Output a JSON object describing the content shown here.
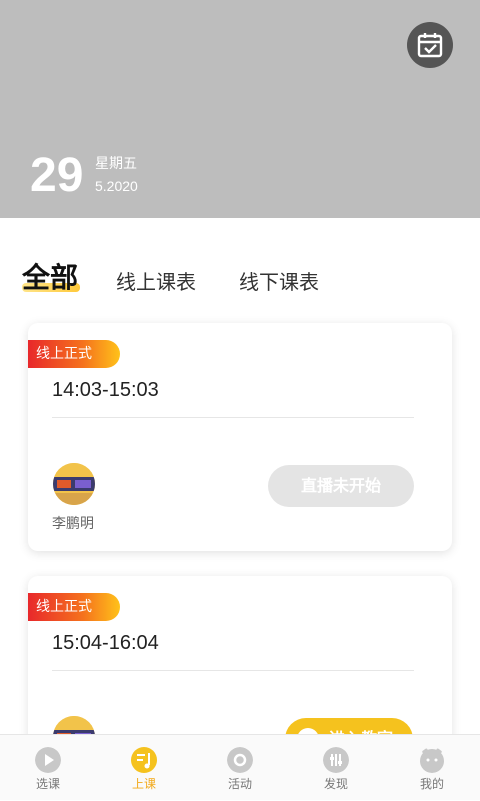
{
  "header": {
    "day": "29",
    "weekday": "星期五",
    "month_year": "5.2020",
    "calendar_icon": "calendar-check-icon"
  },
  "tabs": [
    {
      "label": "全部",
      "active": true
    },
    {
      "label": "线上课表",
      "active": false
    },
    {
      "label": "线下课表",
      "active": false
    }
  ],
  "cards": [
    {
      "badge": "线上正式",
      "time": "14:03-15:03",
      "teacher": "李鹏明",
      "action": "直播未开始",
      "action_state": "disabled"
    },
    {
      "badge": "线上正式",
      "time": "15:04-16:04",
      "action": "进入教室",
      "action_state": "enabled"
    }
  ],
  "bottom_nav": [
    {
      "label": "选课",
      "icon": "play-circle-icon",
      "active": false
    },
    {
      "label": "上课",
      "icon": "music-note-icon",
      "active": true
    },
    {
      "label": "活动",
      "icon": "disc-icon",
      "active": false
    },
    {
      "label": "发现",
      "icon": "sliders-icon",
      "active": false
    },
    {
      "label": "我的",
      "icon": "profile-face-icon",
      "active": false
    }
  ],
  "colors": {
    "accent": "#f5c21e",
    "header_bg": "#bdbdbd",
    "badge_start": "#e8282b",
    "badge_end": "#ffc21a"
  }
}
